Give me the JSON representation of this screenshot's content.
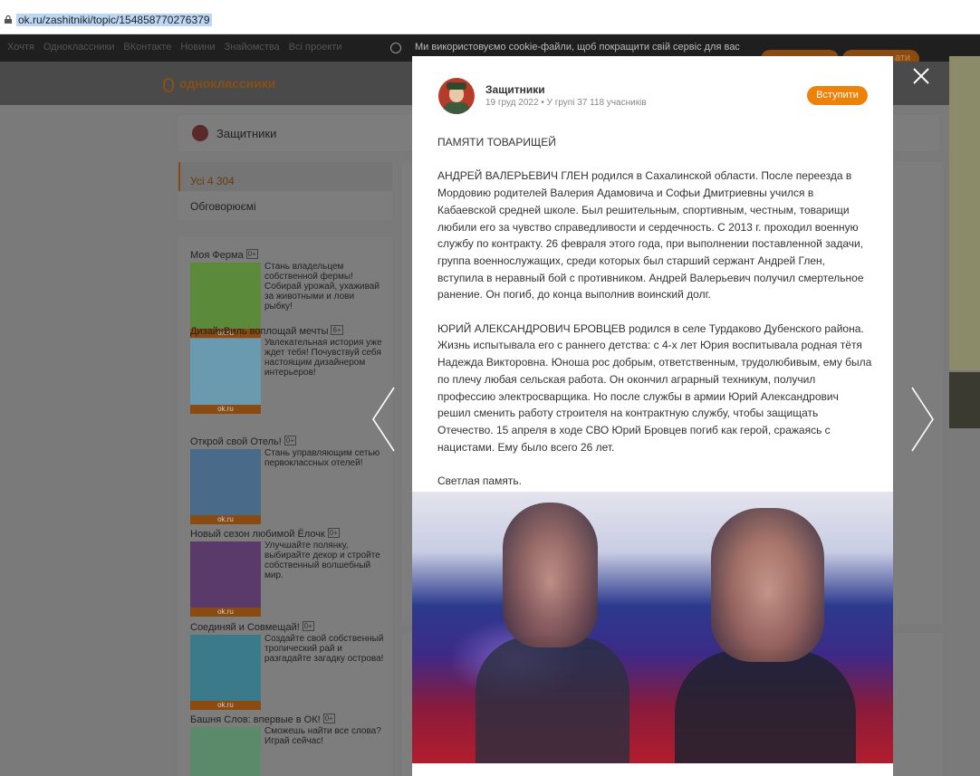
{
  "browser": {
    "url": "ok.ru/zashitniki/topic/154858770276379"
  },
  "underlying": {
    "topnav_links": [
      "Хочтя",
      "Одноклассники",
      "ВКонтакте",
      "Новини",
      "Знайомства",
      "Всі проекти"
    ],
    "cookie_text": "Ми використовуємо cookie-файли, щоб покращити свій сервіс для вас",
    "logo_text": "одноклассники",
    "group_name": "Защитники",
    "filter_all": "Усі 4 304",
    "filter_discussed": "Обговорюємі",
    "games": [
      {
        "title": "Моя Ферма",
        "age": "0+",
        "desc": "Стань владельцем собственной фермы! Собирай урожай, ухаживай за животными и лови рыбку!",
        "thumb_color": "#5a8a3a",
        "badge": "ok.ru"
      },
      {
        "title": "ДизайнВиль воплощай мечты",
        "age": "6+",
        "desc": "Увлекательная история уже ждет тебя! Почувствуй себя настоящим дизайнером интерьеров!",
        "thumb_color": "#6a9ab0",
        "badge": "ok.ru"
      },
      {
        "title": "Открой свой Отель!",
        "age": "0+",
        "desc": "Стань управляющим сетью первоклассных отелей!",
        "thumb_color": "#4a6a8a",
        "badge": "ok.ru"
      },
      {
        "title": "Новый сезон любимой Ёлочк",
        "age": "0+",
        "desc": "Улучшайте полянку, выбирайте декор и стройте собственный волшебный мир.",
        "thumb_color": "#5a3a6a",
        "badge": "ok.ru"
      },
      {
        "title": "Соединяй и Совмещай!",
        "age": "0+",
        "desc": "Создайте свой собственный тропический рай и разгадайте загадку острова!",
        "thumb_color": "#3a7a8a",
        "badge": "ok.ru"
      },
      {
        "title": "Башня Слов: впервые в ОК!",
        "age": "0+",
        "desc": "Сможешь найти все слова? Играй сейчас!",
        "thumb_color": "#5a8a6a",
        "badge": ""
      }
    ]
  },
  "modal": {
    "group_name": "Защитники",
    "meta": "19 груд 2022 • У групі 37 118 учасників",
    "join_label": "Вступити",
    "paragraphs": [
      "ПАМЯТИ ТОВАРИЩЕЙ",
      "АНДРЕЙ ВАЛЕРЬЕВИЧ ГЛЕН родился в Сахалинской области. После переезда в Мордовию родителей Валерия Адамовича и Софьи Дмитриевны учился в Кабаевской средней школе. Был решительным, спортивным, честным, товарищи любили его за чувство справедливости и сердечность. С 2013 г. проходил военную службу по контракту. 26 февраля этого года, при выполнении поставленной задачи, группа военнослужащих, среди которых был старший сержант Андрей Глен, вступила в неравный бой с противником. Андрей Валерьевич получил смертельное ранение. Он погиб, до конца выполнив воинский долг.",
      "ЮРИЙ АЛЕКСАНДРОВИЧ БРОВЦЕВ родился в селе Турдаково Дубенского района. Жизнь испытывала его с раннего детства: с 4-х лет Юрия воспитывала родная тётя Надежда Викторовна. Юноша рос добрым, ответственным, трудолюбивым, ему была по плечу любая сельская работа. Он окончил аграрный техникум, получил профессию электросварщика. Но после службы в армии Юрий Александрович решил сменить работу строителя на контрактную службу, чтобы защищать Отечество. 15 апреля в ходе СВО Юрий Бровцев погиб как герой, сражаясь с нацистами. Ему было всего 26 лет.",
      "Светлая память."
    ],
    "accent_color": "#ee8208"
  }
}
